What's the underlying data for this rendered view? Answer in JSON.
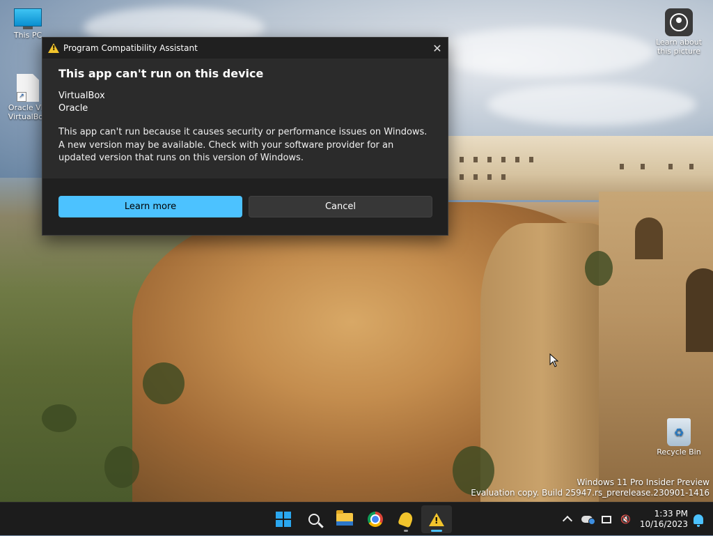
{
  "desktop": {
    "icons": {
      "this_pc": "This PC",
      "oracle_vm": "Oracle VM VirtualBox",
      "learn_picture": "Learn about this picture",
      "recycle_bin": "Recycle Bin"
    },
    "watermark": {
      "line1": "Windows 11 Pro Insider Preview",
      "line2": "Evaluation copy. Build 25947.rs_prerelease.230901-1416"
    }
  },
  "dialog": {
    "window_title": "Program Compatibility Assistant",
    "heading": "This app can't run on this device",
    "app_name": "VirtualBox",
    "publisher": "Oracle",
    "description": "This app can't run because it causes security or performance issues on Windows. A new version may be available. Check with your software provider for an updated version that runs on this version of Windows.",
    "primary_button": "Learn more",
    "secondary_button": "Cancel",
    "close_glyph": "✕",
    "colors": {
      "accent": "#4cc2ff",
      "background": "#2b2b2b",
      "warning": "#f2c42c"
    }
  },
  "taskbar": {
    "apps": [
      "start-icon",
      "search-icon",
      "file-explorer-icon",
      "chrome-icon",
      "tips-icon",
      "compatibility-assistant-icon"
    ],
    "active_app": "compatibility-assistant-icon",
    "clock": {
      "time": "1:33 PM",
      "date": "10/16/2023"
    }
  }
}
